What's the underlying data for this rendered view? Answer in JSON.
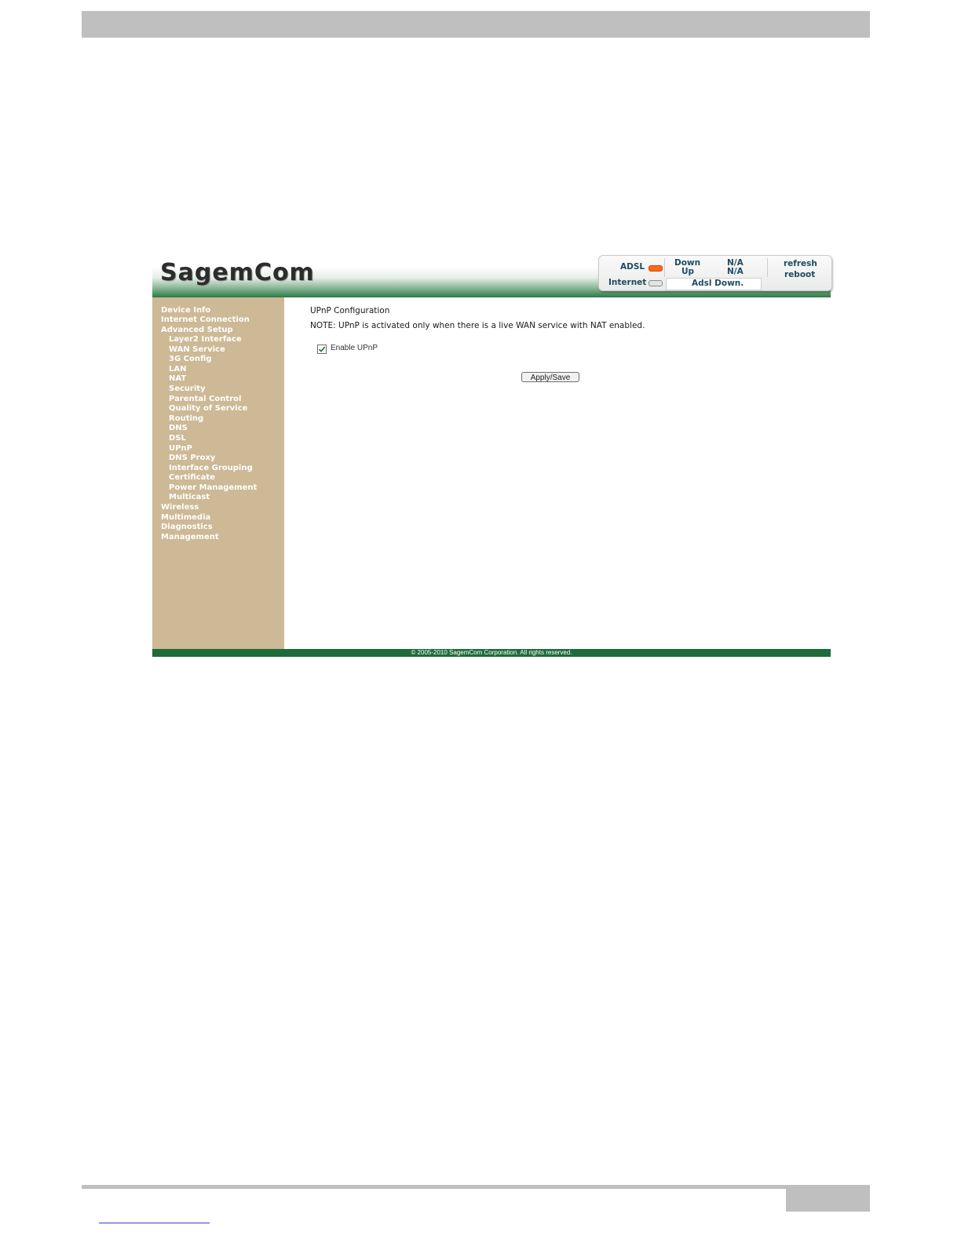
{
  "header": {
    "logo_text": "SagemCom"
  },
  "status_panel": {
    "adsl_label": "ADSL",
    "internet_label": "Internet",
    "down_label": "Down",
    "up_label": "Up",
    "down_value": "N/A",
    "up_value": "N/A",
    "adsl_status": "Adsl Down.",
    "refresh_label": "refresh",
    "reboot_label": "reboot",
    "adsl_led_color": "#ff6a1a",
    "internet_led_color": "#e3e3e3"
  },
  "sidebar": {
    "items": [
      {
        "label": "Device Info"
      },
      {
        "label": "Internet Connection"
      },
      {
        "label": "Advanced Setup"
      },
      {
        "label": "Layer2 Interface"
      },
      {
        "label": "WAN Service"
      },
      {
        "label": "3G Config"
      },
      {
        "label": "LAN"
      },
      {
        "label": "NAT"
      },
      {
        "label": "Security"
      },
      {
        "label": "Parental Control"
      },
      {
        "label": "Quality of Service"
      },
      {
        "label": "Routing"
      },
      {
        "label": "DNS"
      },
      {
        "label": "DSL"
      },
      {
        "label": "UPnP"
      },
      {
        "label": "DNS Proxy"
      },
      {
        "label": "Interface Grouping"
      },
      {
        "label": "Certificate"
      },
      {
        "label": "Power Management"
      },
      {
        "label": "Multicast"
      },
      {
        "label": "Wireless"
      },
      {
        "label": "Multimedia"
      },
      {
        "label": "Diagnostics"
      },
      {
        "label": "Management"
      }
    ]
  },
  "main": {
    "title": "UPnP Configuration",
    "note": "NOTE: UPnP is activated only when there is a live WAN service with NAT enabled.",
    "enable_label": "Enable UPnP",
    "enable_checked": true,
    "apply_label": "Apply/Save"
  },
  "footer": {
    "copyright": "© 2005-2010 SagemCom Corporation. All rights reserved."
  },
  "colors": {
    "sidebar_bg": "#cdb995",
    "brand_green": "#1f6b3a",
    "doc_gray": "#bfbfbf"
  }
}
